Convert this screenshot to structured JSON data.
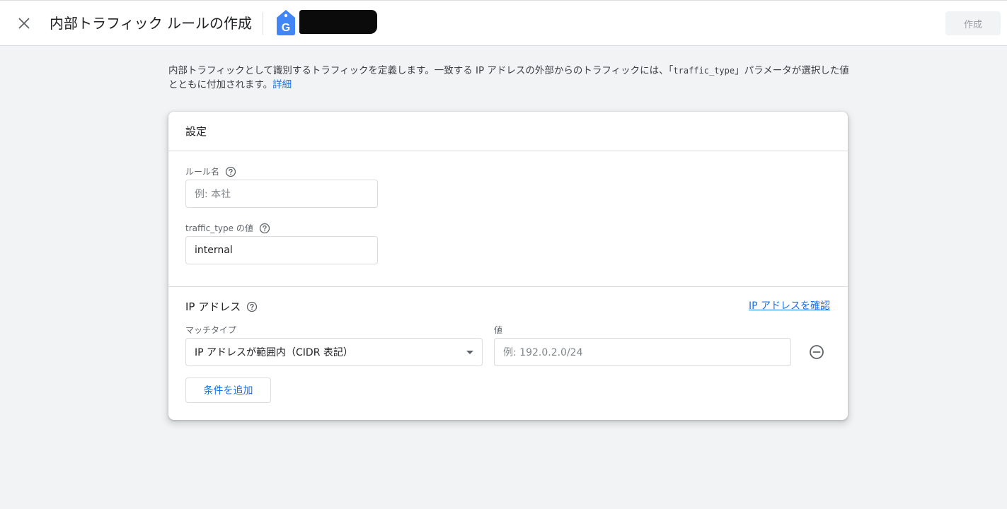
{
  "header": {
    "title": "内部トラフィック ルールの作成",
    "create_label": "作成",
    "close_icon": "close-icon",
    "property_icon": "google-tag-icon"
  },
  "description": {
    "text_before": "内部トラフィックとして識別するトラフィックを定義します。一致する IP アドレスの外部からのトラフィックには、「",
    "code": "traffic_type",
    "text_after": "」パラメータが選択した値とともに付加されます。",
    "link": "詳細"
  },
  "card": {
    "title": "設定",
    "rule_name": {
      "label": "ルール名",
      "placeholder": "例: 本社",
      "value": ""
    },
    "traffic_type": {
      "label": "traffic_type の値",
      "value": "internal"
    },
    "ip_section": {
      "title": "IP アドレス",
      "check_link": "IP アドレスを確認",
      "match_type_label": "マッチタイプ",
      "match_type_value": "IP アドレスが範囲内（CIDR 表記）",
      "value_label": "値",
      "value_placeholder": "例: 192.0.2.0/24",
      "add_condition": "条件を追加"
    }
  },
  "colors": {
    "accent": "#1a73e8",
    "background": "#f1f3f4",
    "border": "#dadce0",
    "tag_blue": "#4285f4"
  }
}
